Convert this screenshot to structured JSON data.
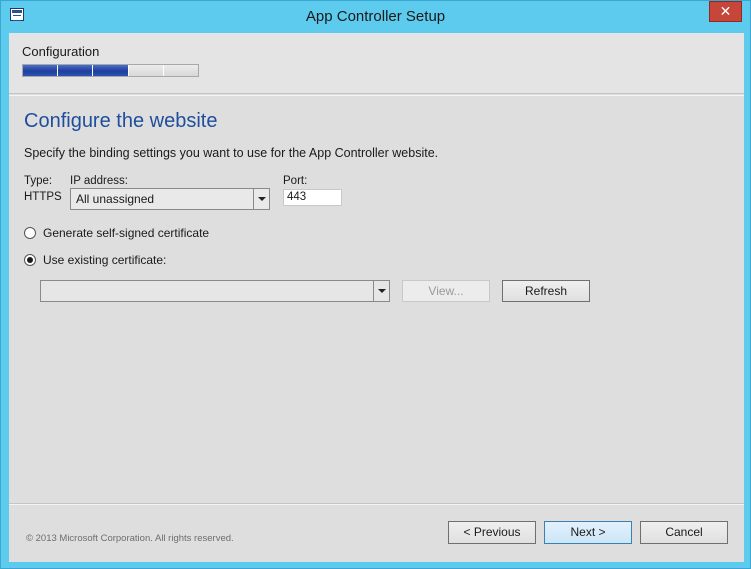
{
  "window": {
    "title": "App Controller Setup",
    "close_label": "✕"
  },
  "header": {
    "step_label": "Configuration",
    "progress": {
      "completed_steps": 3,
      "total_steps": 5
    }
  },
  "page": {
    "heading": "Configure the website",
    "instruction": "Specify the binding settings you want to use for the App Controller website."
  },
  "binding": {
    "type_label": "Type:",
    "type_value": "HTTPS",
    "ip_label": "IP address:",
    "ip_value": "All unassigned",
    "port_label": "Port:",
    "port_value": "443"
  },
  "certificate": {
    "option_generate": "Generate self-signed certificate",
    "option_existing": "Use existing certificate:",
    "selected_option": "existing",
    "selected_certificate": "",
    "view_label": "View...",
    "refresh_label": "Refresh"
  },
  "footer": {
    "copyright": "© 2013 Microsoft Corporation. All rights reserved.",
    "previous_label": "< Previous",
    "next_label": "Next >",
    "cancel_label": "Cancel"
  },
  "colors": {
    "title_bar": "#5ccbee",
    "heading": "#1f4e9c",
    "progress_fill": "#1f3f9c",
    "close_button": "#c7463a"
  }
}
